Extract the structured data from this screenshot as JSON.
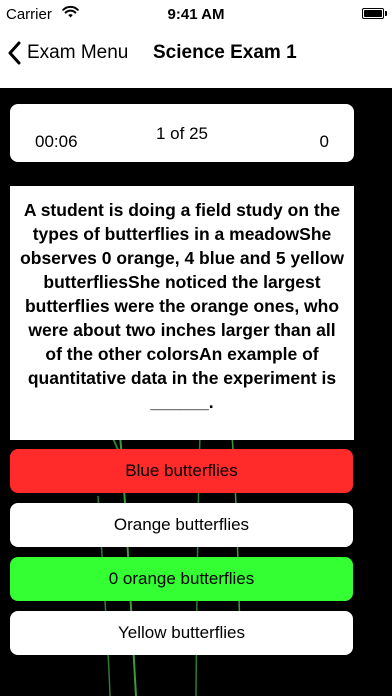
{
  "status_bar": {
    "carrier": "Carrier",
    "time": "9:41 AM",
    "wifi_icon": "wifi-icon",
    "battery_icon": "battery-icon"
  },
  "nav": {
    "back_label": "Exam Menu",
    "back_icon": "chevron-left-icon",
    "title": "Science Exam 1"
  },
  "stats": {
    "timer": "00:06",
    "progress": "1 of 25",
    "score": "0"
  },
  "question": {
    "text": "A student is doing a field study on the types of butterflies in a meadowShe observes 0 orange, 4 blue and 5 yellow butterfliesShe noticed the largest butterflies were the orange ones, who were about two inches larger than all of the other colorsAn example of quantitative data in the experiment is ______."
  },
  "answers": [
    {
      "label": "Blue butterflies",
      "state": "incorrect",
      "color": "#ff2a2a"
    },
    {
      "label": "Orange butterflies",
      "state": "neutral",
      "color": "#ffffff"
    },
    {
      "label": "0 orange butterflies",
      "state": "correct",
      "color": "#33ff33"
    },
    {
      "label": "Yellow butterflies",
      "state": "neutral",
      "color": "#ffffff"
    }
  ],
  "colors": {
    "background": "#000000",
    "panel": "#ffffff",
    "incorrect": "#ff2a2a",
    "correct": "#33ff33"
  }
}
